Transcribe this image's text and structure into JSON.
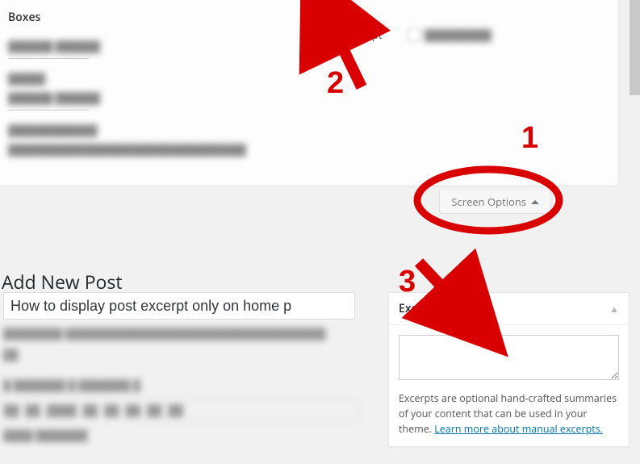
{
  "boxes": {
    "panel_title": "Boxes",
    "excerpt_checkbox_label": "Excerpt"
  },
  "screen_options": {
    "label": "Screen Options"
  },
  "editor": {
    "page_heading": "Add New Post",
    "title_value": "How to display post excerpt only on home p"
  },
  "excerpt_box": {
    "heading": "Excerpt",
    "textarea_value": "",
    "description_before_link": "Excerpts are optional hand-crafted summaries of your content that can be used in your theme. ",
    "description_link_text": "Learn more about manual excerpts."
  },
  "annotations": {
    "one": "1",
    "two": "2",
    "three": "3"
  }
}
